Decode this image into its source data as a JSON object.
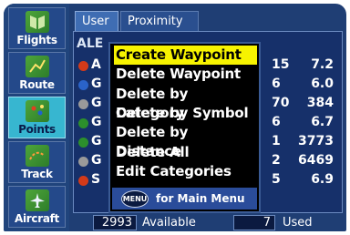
{
  "sidebar": {
    "items": [
      {
        "label": "Flights",
        "icon": "flights-book-icon",
        "active": false
      },
      {
        "label": "Route",
        "icon": "route-map-icon",
        "active": false
      },
      {
        "label": "Points",
        "icon": "points-map-icon",
        "active": true
      },
      {
        "label": "Track",
        "icon": "track-icon",
        "active": false
      },
      {
        "label": "Aircraft",
        "icon": "aircraft-icon",
        "active": false
      }
    ]
  },
  "tabs": [
    {
      "label": "User",
      "active": true
    },
    {
      "label": "Proximity",
      "active": false
    }
  ],
  "list": {
    "search": "ALE",
    "rows": [
      {
        "prefix": "A",
        "marker_color": "#d33a1a",
        "dist1": "15",
        "dist2": "7.2"
      },
      {
        "prefix": "G",
        "marker_color": "#2a63c9",
        "dist1": "6",
        "dist2": "6.0"
      },
      {
        "prefix": "G",
        "marker_color": "#9a9a9a",
        "dist1": "70",
        "dist2": "384"
      },
      {
        "prefix": "G",
        "marker_color": "#2c8f2c",
        "dist1": "6",
        "dist2": "6.7"
      },
      {
        "prefix": "G",
        "marker_color": "#2c8f2c",
        "dist1": "1",
        "dist2": "3773"
      },
      {
        "prefix": "G",
        "marker_color": "#9a9a9a",
        "dist1": "2",
        "dist2": "6469"
      },
      {
        "prefix": "S",
        "marker_color": "#d33a1a",
        "dist1": "5",
        "dist2": "6.9"
      }
    ]
  },
  "menu": {
    "items": [
      {
        "label": "Create Waypoint",
        "selected": true
      },
      {
        "label": "Delete Waypoint",
        "selected": false
      },
      {
        "label": "Delete by Category",
        "selected": false
      },
      {
        "label": "Delete by Symbol",
        "selected": false
      },
      {
        "label": "Delete by Distance",
        "selected": false
      },
      {
        "label": "Delete All",
        "selected": false
      },
      {
        "label": "Edit Categories",
        "selected": false
      }
    ],
    "footer_button": "MENU",
    "footer_label": "for Main Menu"
  },
  "footer": {
    "available_count": "2993",
    "available_label": "Available",
    "used_count": "7",
    "used_label": "Used"
  }
}
